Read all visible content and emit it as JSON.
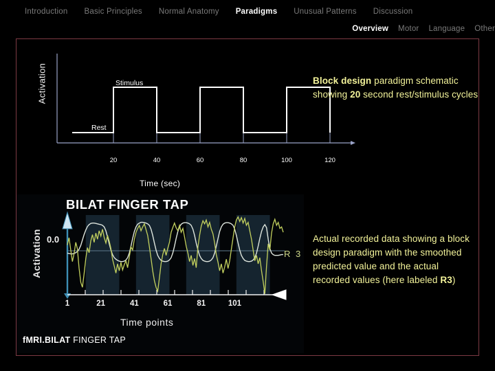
{
  "nav": {
    "main_items": [
      {
        "label": "Introduction",
        "active": false
      },
      {
        "label": "Basic Principles",
        "active": false
      },
      {
        "label": "Normal Anatomy",
        "active": false
      },
      {
        "label": "Paradigms",
        "active": true
      },
      {
        "label": "Unusual Patterns",
        "active": false
      },
      {
        "label": "Discussion",
        "active": false
      }
    ],
    "sub_items": [
      {
        "label": "Overview",
        "active": true
      },
      {
        "label": "Motor",
        "active": false
      },
      {
        "label": "Language",
        "active": false
      },
      {
        "label": "Other",
        "active": false
      }
    ]
  },
  "colors": {
    "frame_border": "#7d3a44",
    "annotation_text": "#f3f39a",
    "schematic_axis": "#9aa3c8",
    "schematic_wave": "#ffffff",
    "data_recorded": "#c3d15e",
    "data_predicted": "#dfe6de",
    "data_band": "#15242f",
    "data_axis": "#3e8fb5"
  },
  "annotations": {
    "top": "Block design paradigm schematic showing 20 second rest/stimulus cycles",
    "top_bold_1": "Block design",
    "top_rest_1": " paradigm schematic showing ",
    "top_bold_2": "20",
    "top_rest_2": " second rest/stimulus cycles",
    "bottom": "Actual recorded data showing a block design paradigm with the smoothed predicted value and the actual recorded values (here labeled R3)",
    "bottom_rest_1": "Actual recorded data showing a block design paradigm with the smoothed predicted value and the actual recorded values (here labeled ",
    "bottom_bold": "R3",
    "bottom_rest_2": ")"
  },
  "schematic": {
    "ylabel": "Activation",
    "xlabel": "Time (sec)",
    "rest_label": "Rest",
    "stimulus_label": "Stimulus"
  },
  "data_image": {
    "title": "BILAT FINGER TAP",
    "ylabel": "Activation",
    "zero_label": "0.0",
    "series_label": "R 3",
    "xlabel": "Time points",
    "caption_bold": "fMRI.BILAT",
    "caption_rest": " FINGER TAP"
  },
  "chart_data": [
    {
      "type": "line",
      "id": "block-design-schematic",
      "title": "Block design paradigm schematic",
      "xlabel": "Time (sec)",
      "ylabel": "Activation",
      "xlim": [
        0,
        140
      ],
      "ylim": [
        0,
        1
      ],
      "xticks": [
        20,
        40,
        60,
        80,
        100,
        120
      ],
      "xtick_labels": [
        "20",
        "40",
        "60",
        "80",
        "100",
        "120"
      ],
      "grid": false,
      "legend": "none",
      "annotations": [
        {
          "text": "Rest",
          "x": 10,
          "y": 0.18
        },
        {
          "text": "Stimulus",
          "x": 30,
          "y": 1.12
        }
      ],
      "series": [
        {
          "name": "block-design",
          "comment": "square wave: low = rest, high = stimulus, 20 s blocks",
          "x": [
            0,
            20,
            20,
            40,
            40,
            60,
            60,
            80,
            80,
            100,
            100,
            120,
            120
          ],
          "values": [
            0,
            0,
            1,
            1,
            0,
            0,
            1,
            1,
            0,
            0,
            1,
            1,
            0
          ]
        }
      ]
    },
    {
      "type": "line",
      "id": "bilat-finger-tap-recorded",
      "title": "BILAT FINGER TAP",
      "xlabel": "Time points",
      "ylabel": "Activation",
      "xlim": [
        1,
        125
      ],
      "ylim": [
        -1.15,
        1.0
      ],
      "xticks": [
        1,
        21,
        41,
        61,
        81,
        101
      ],
      "xtick_labels": [
        "1",
        "21",
        "41",
        "61",
        "81",
        "101"
      ],
      "yticks": [
        0.0
      ],
      "ytick_labels": [
        "0.0"
      ],
      "grid": false,
      "legend": "inline-right",
      "shaded_bands": [
        {
          "x0": 12,
          "x1": 32
        },
        {
          "x0": 42,
          "x1": 62
        },
        {
          "x0": 72,
          "x1": 92
        },
        {
          "x0": 102,
          "x1": 122
        }
      ],
      "series": [
        {
          "name": "R 3",
          "role": "actual recorded values",
          "color": "#c3d15e",
          "values": [
            0.15,
            0.34,
            0.02,
            -0.28,
            -0.08,
            0.22,
            0.05,
            -0.45,
            -0.82,
            -0.95,
            -0.6,
            -0.2,
            0.08,
            -0.05,
            0.26,
            0.42,
            0.22,
            0.46,
            0.3,
            0.52,
            0.38,
            0.56,
            0.34,
            0.2,
            0.4,
            0.25,
            0.06,
            -0.22,
            -0.4,
            -0.58,
            -0.34,
            -0.52,
            -0.3,
            -0.5,
            -0.36,
            -0.26,
            -0.44,
            -0.16,
            0.1,
            0.02,
            0.3,
            0.48,
            0.58,
            0.66,
            0.52,
            0.62,
            0.7,
            0.55,
            0.4,
            0.1,
            -0.2,
            -0.52,
            -0.78,
            -0.95,
            -1.05,
            -0.7,
            -0.34,
            -0.1,
            0.06,
            -0.12,
            0.06,
            0.22,
            0.48,
            0.6,
            0.72,
            0.6,
            0.52,
            0.66,
            0.48,
            0.58,
            0.36,
            0.12,
            -0.06,
            -0.28,
            -0.12,
            -0.38,
            -0.2,
            -0.44,
            0.1,
            0.4,
            0.64,
            0.78,
            0.7,
            0.8,
            0.62,
            0.74,
            0.56,
            0.44,
            0.2,
            -0.1,
            -0.3,
            -0.52,
            -0.34,
            -0.58,
            -0.42,
            -0.22,
            -0.46,
            -0.26,
            0.04,
            0.34,
            0.62,
            0.8,
            0.88,
            0.76,
            0.86,
            0.72,
            0.84,
            0.66,
            0.74,
            0.52,
            0.3,
            0.02,
            -0.26,
            -0.12,
            -0.34,
            -0.18,
            -0.52,
            -0.8,
            -1.12,
            -0.4,
            0.18,
            0.02,
            0.46,
            0.7,
            0.82,
            0.66,
            0.74,
            0.58,
            0.62,
            0.48
          ]
        },
        {
          "name": "predicted",
          "role": "smoothed predicted value",
          "color": "#dfe6de",
          "values": [
            -0.06,
            -0.07,
            -0.08,
            -0.08,
            -0.07,
            -0.05,
            -0.02,
            0.04,
            0.14,
            0.28,
            0.42,
            0.54,
            0.63,
            0.68,
            0.71,
            0.72,
            0.72,
            0.71,
            0.7,
            0.69,
            0.68,
            0.66,
            0.62,
            0.52,
            0.36,
            0.18,
            0.02,
            -0.1,
            -0.18,
            -0.22,
            -0.25,
            -0.27,
            -0.28,
            -0.28,
            -0.27,
            -0.24,
            -0.18,
            -0.06,
            0.12,
            0.32,
            0.5,
            0.62,
            0.69,
            0.72,
            0.74,
            0.74,
            0.73,
            0.72,
            0.7,
            0.66,
            0.56,
            0.4,
            0.2,
            0.02,
            -0.12,
            -0.2,
            -0.25,
            -0.27,
            -0.28,
            -0.28,
            -0.27,
            -0.24,
            -0.18,
            -0.06,
            0.12,
            0.32,
            0.5,
            0.62,
            0.69,
            0.72,
            0.73,
            0.73,
            0.72,
            0.7,
            0.66,
            0.56,
            0.4,
            0.2,
            0.02,
            -0.12,
            -0.2,
            -0.25,
            -0.27,
            -0.28,
            -0.28,
            -0.27,
            -0.24,
            -0.18,
            -0.06,
            0.12,
            0.32,
            0.5,
            0.62,
            0.69,
            0.72,
            0.73,
            0.73,
            0.72,
            0.7,
            0.66,
            0.56,
            0.4,
            0.2,
            0.02,
            -0.12,
            -0.2,
            -0.25,
            -0.27,
            -0.28,
            -0.28,
            -0.27,
            -0.24,
            -0.18,
            -0.06,
            0.12,
            0.32,
            0.5,
            0.62,
            0.68,
            0.6,
            0.3,
            0.06,
            -0.06,
            -0.1,
            -0.12,
            -0.12,
            -0.12,
            -0.11,
            -0.1,
            -0.1
          ]
        }
      ]
    }
  ]
}
